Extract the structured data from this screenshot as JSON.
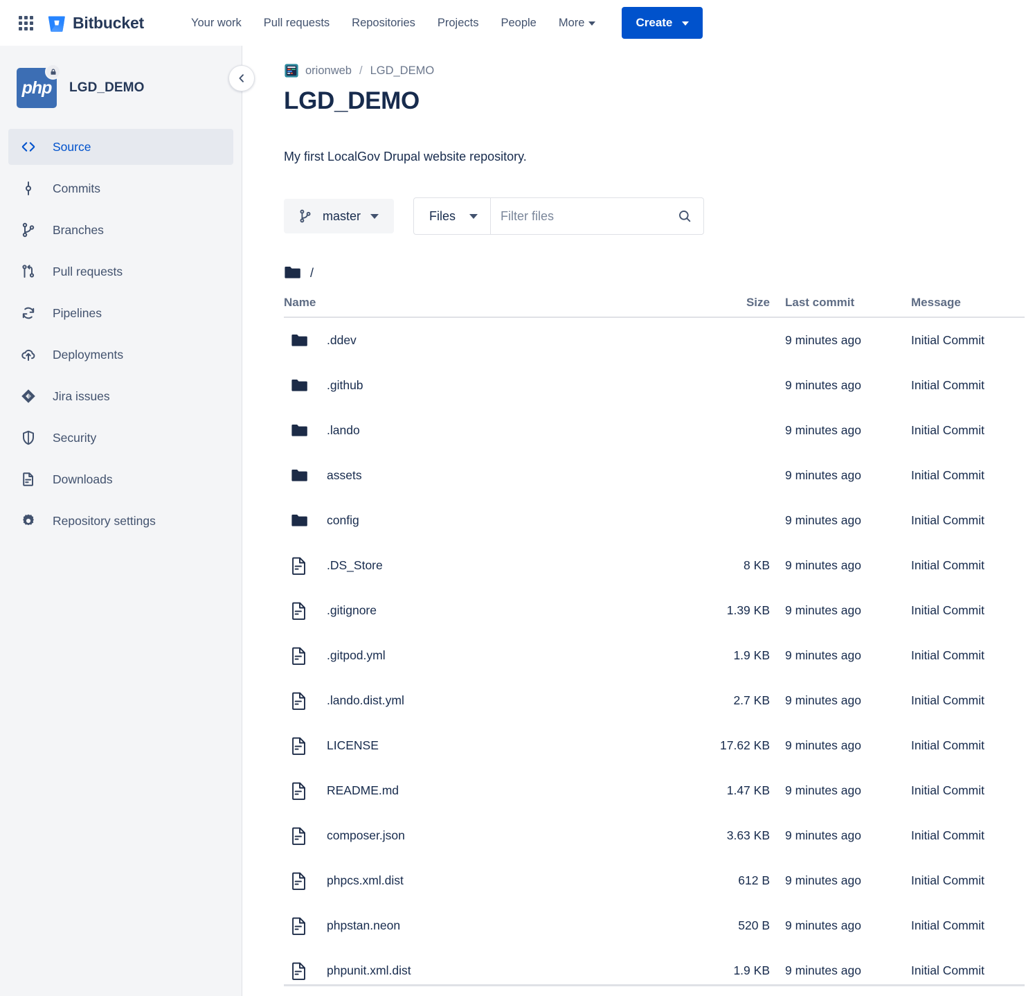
{
  "topnav": {
    "app_switcher_label": "App switcher",
    "brand": "Bitbucket",
    "links": [
      {
        "label": "Your work",
        "has_chevron": false
      },
      {
        "label": "Pull requests",
        "has_chevron": false
      },
      {
        "label": "Repositories",
        "has_chevron": false
      },
      {
        "label": "Projects",
        "has_chevron": false
      },
      {
        "label": "People",
        "has_chevron": false
      },
      {
        "label": "More",
        "has_chevron": true
      }
    ],
    "create_label": "Create"
  },
  "sidebar": {
    "repo_name": "LGD_DEMO",
    "avatar_text": "php",
    "avatar_color": "#3C6EB4",
    "is_private": true,
    "collapse_label": "Collapse sidebar",
    "items": [
      {
        "label": "Source",
        "icon": "code-icon",
        "active": true
      },
      {
        "label": "Commits",
        "icon": "commit-icon",
        "active": false
      },
      {
        "label": "Branches",
        "icon": "branch-icon",
        "active": false
      },
      {
        "label": "Pull requests",
        "icon": "pull-request-icon",
        "active": false
      },
      {
        "label": "Pipelines",
        "icon": "pipeline-icon",
        "active": false
      },
      {
        "label": "Deployments",
        "icon": "deployment-icon",
        "active": false
      },
      {
        "label": "Jira issues",
        "icon": "jira-icon",
        "active": false
      },
      {
        "label": "Security",
        "icon": "shield-icon",
        "active": false
      },
      {
        "label": "Downloads",
        "icon": "download-file-icon",
        "active": false
      },
      {
        "label": "Repository settings",
        "icon": "gear-icon",
        "active": false
      }
    ]
  },
  "main": {
    "breadcrumb": {
      "workspace": "orionweb",
      "separator": "/",
      "repo": "LGD_DEMO"
    },
    "page_title": "LGD_DEMO",
    "description": "My first LocalGov Drupal website repository.",
    "toolbar": {
      "branch": "master",
      "view_type": "Files",
      "filter_placeholder": "Filter files",
      "filter_value": ""
    },
    "path": "/",
    "table": {
      "headers": {
        "name": "Name",
        "size": "Size",
        "last_commit": "Last commit",
        "message": "Message"
      },
      "rows": [
        {
          "type": "folder",
          "name": ".ddev",
          "size": "",
          "last_commit": "9 minutes ago",
          "message": "Initial Commit"
        },
        {
          "type": "folder",
          "name": ".github",
          "size": "",
          "last_commit": "9 minutes ago",
          "message": "Initial Commit"
        },
        {
          "type": "folder",
          "name": ".lando",
          "size": "",
          "last_commit": "9 minutes ago",
          "message": "Initial Commit"
        },
        {
          "type": "folder",
          "name": "assets",
          "size": "",
          "last_commit": "9 minutes ago",
          "message": "Initial Commit"
        },
        {
          "type": "folder",
          "name": "config",
          "size": "",
          "last_commit": "9 minutes ago",
          "message": "Initial Commit"
        },
        {
          "type": "file",
          "name": ".DS_Store",
          "size": "8 KB",
          "last_commit": "9 minutes ago",
          "message": "Initial Commit"
        },
        {
          "type": "file",
          "name": ".gitignore",
          "size": "1.39 KB",
          "last_commit": "9 minutes ago",
          "message": "Initial Commit"
        },
        {
          "type": "file",
          "name": ".gitpod.yml",
          "size": "1.9 KB",
          "last_commit": "9 minutes ago",
          "message": "Initial Commit"
        },
        {
          "type": "file",
          "name": ".lando.dist.yml",
          "size": "2.7 KB",
          "last_commit": "9 minutes ago",
          "message": "Initial Commit"
        },
        {
          "type": "file",
          "name": "LICENSE",
          "size": "17.62 KB",
          "last_commit": "9 minutes ago",
          "message": "Initial Commit"
        },
        {
          "type": "file",
          "name": "README.md",
          "size": "1.47 KB",
          "last_commit": "9 minutes ago",
          "message": "Initial Commit"
        },
        {
          "type": "file",
          "name": "composer.json",
          "size": "3.63 KB",
          "last_commit": "9 minutes ago",
          "message": "Initial Commit"
        },
        {
          "type": "file",
          "name": "phpcs.xml.dist",
          "size": "612 B",
          "last_commit": "9 minutes ago",
          "message": "Initial Commit"
        },
        {
          "type": "file",
          "name": "phpstan.neon",
          "size": "520 B",
          "last_commit": "9 minutes ago",
          "message": "Initial Commit"
        },
        {
          "type": "file",
          "name": "phpunit.xml.dist",
          "size": "1.9 KB",
          "last_commit": "9 minutes ago",
          "message": "Initial Commit"
        }
      ]
    }
  },
  "colors": {
    "brand_blue": "#0052CC",
    "text_dark": "#172B4D",
    "text_muted": "#6B778C",
    "sidebar_bg": "#F4F5F7",
    "border": "#DFE1E6",
    "icon_dark": "#1C2B47"
  }
}
